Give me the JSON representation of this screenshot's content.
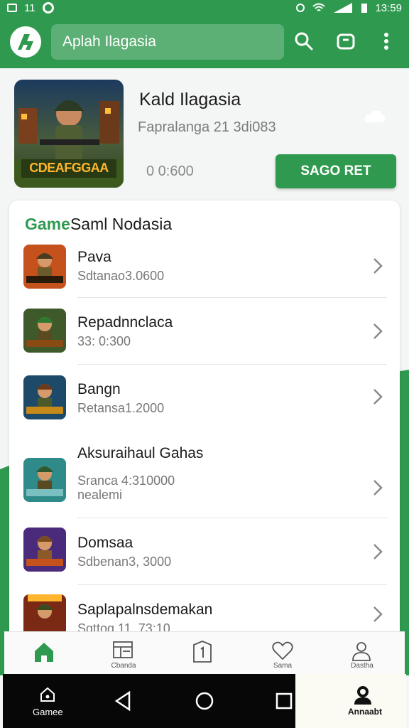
{
  "status_bar": {
    "left_text": "11",
    "time": "13:59"
  },
  "search": {
    "value": "Aplah Ilagasia"
  },
  "hero": {
    "title": "Kald Ilagasia",
    "subtitle": "Fapralanga 21 3di083",
    "size": "0 0:600",
    "button_label": "SAGO RET",
    "art_text": "CDEAFGGAA"
  },
  "section": {
    "accent": "Game",
    "title": "Saml Nodasia"
  },
  "games": [
    {
      "name": "Pava",
      "meta": "Sdtanao3.0600"
    },
    {
      "name": "Repadnnclaca",
      "meta": "33: 0:300"
    },
    {
      "name": "Bangn",
      "meta": "Retansa1.2000"
    },
    {
      "name": "Aksuraihaul Gahas",
      "meta": "Sranca 4:310000",
      "meta2": "nealemi"
    },
    {
      "name": "Domsaa",
      "meta": "Sdbenan3, 3000"
    },
    {
      "name": "Saplapalnsdemakan",
      "meta": "Sgttog 11. 73:10"
    }
  ],
  "bottom_nav": {
    "items": [
      {
        "label": "",
        "icon": "home-icon"
      },
      {
        "label": "Cbanda",
        "icon": "list-icon"
      },
      {
        "label": "",
        "icon": "badge-icon"
      },
      {
        "label": "Sama",
        "icon": "heart-icon"
      },
      {
        "label": "Dastha",
        "icon": "user-icon"
      }
    ]
  },
  "system_nav": {
    "left_label": "Gamee",
    "right_label": "Annaabt"
  },
  "colors": {
    "brand": "#2f9a4f",
    "background": "#f4f6f5"
  }
}
